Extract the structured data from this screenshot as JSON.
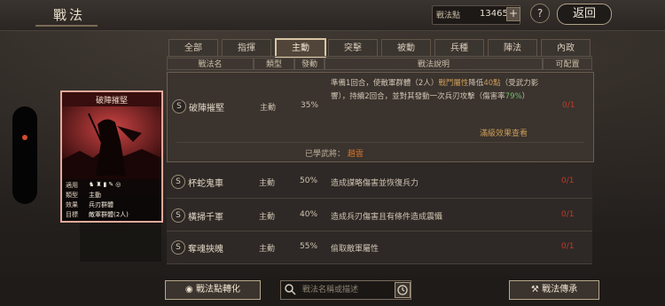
{
  "header": {
    "title": "戰法",
    "points_label": "戰法點",
    "points_value": "13465",
    "plus": "+",
    "help": "?",
    "back_label": "返回"
  },
  "tabs": [
    "全部",
    "指揮",
    "主動",
    "突擊",
    "被動",
    "兵種",
    "陣法",
    "內政"
  ],
  "active_tab": "主動",
  "columns": [
    "戰法名",
    "類型",
    "發動",
    "戰法說明",
    "可配置"
  ],
  "selected_card": {
    "title": "破陣摧堅",
    "fit_label": "適用",
    "type_label": "類型",
    "type_value": "主動",
    "effect_label": "效果",
    "effect_value": "兵刃群體",
    "target_label": "目標",
    "target_value": "敵軍群體(2人)"
  },
  "rows": [
    {
      "badge": "S",
      "name": "破陣摧堅",
      "type": "主動",
      "rate": "35%",
      "desc_parts": [
        "準備1回合，使敵軍群體（2人）",
        "戰鬥屬性",
        "降低",
        "40點",
        "（受武力影響），持續2回合，並對其發動一次兵刃攻擊（傷害率",
        "79%",
        "）"
      ],
      "config": "0/1",
      "more_link": "滿級效果查看",
      "learned_label": "已學武將：",
      "learned_name": "趙雲"
    },
    {
      "badge": "S",
      "name": "杯蛇鬼車",
      "type": "主動",
      "rate": "50%",
      "desc": "造成謀略傷害並恢復兵力",
      "config": "0/1"
    },
    {
      "badge": "S",
      "name": "橫掃千軍",
      "type": "主動",
      "rate": "40%",
      "desc": "造成兵刃傷害且有條件造成震懾",
      "config": "0/1"
    },
    {
      "badge": "S",
      "name": "奪魂挾魄",
      "type": "主動",
      "rate": "55%",
      "desc": "偷取敵軍屬性",
      "config": "0/1"
    }
  ],
  "bottom": {
    "convert_label": "戰法點轉化",
    "search_placeholder": "戰法名稱或描述",
    "inherit_label": "戰法傳承"
  }
}
